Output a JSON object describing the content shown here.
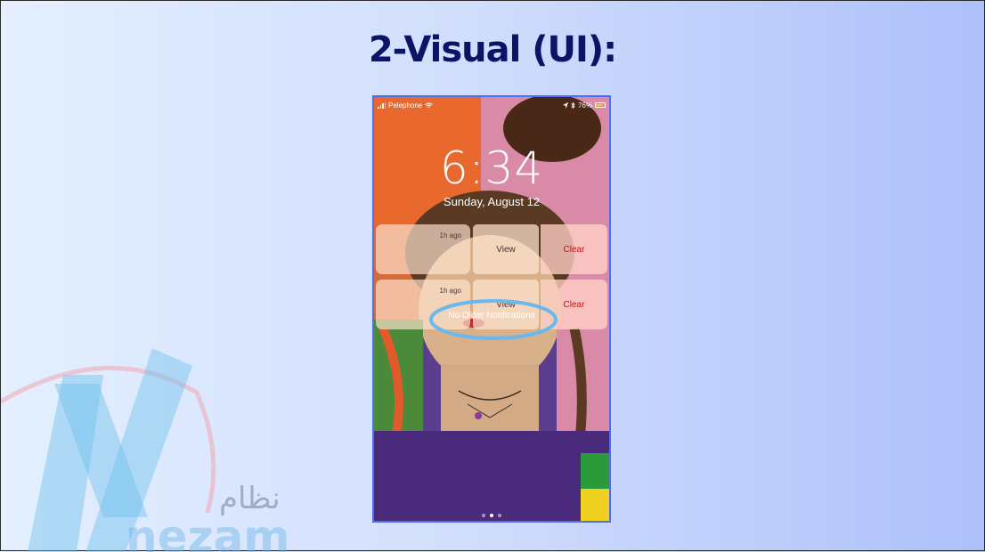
{
  "slide": {
    "title": "2-Visual (UI):",
    "watermark": {
      "arabic": "نظام",
      "latin": "nezam"
    }
  },
  "phone": {
    "status": {
      "carrier": "Pelephone",
      "battery": "76%",
      "battery_level": 0.76,
      "icons": [
        "signal-icon",
        "wifi-icon",
        "location-arrow-icon",
        "bluetooth-icon",
        "battery-icon"
      ]
    },
    "time": "6:34",
    "date": "Sunday, August 12",
    "notifications": [
      {
        "time_ago": "1h ago",
        "view_label": "View",
        "clear_label": "Clear"
      },
      {
        "time_ago": "1h ago",
        "view_label": "View",
        "clear_label": "Clear"
      }
    ],
    "no_older_text": "No Older Notifications",
    "page_count": 3,
    "active_page": 2
  },
  "colors": {
    "title": "#0d1466",
    "phone_border": "#4f6ff0",
    "annotation": "#6ab8f0",
    "clear_text": "#b81818"
  }
}
